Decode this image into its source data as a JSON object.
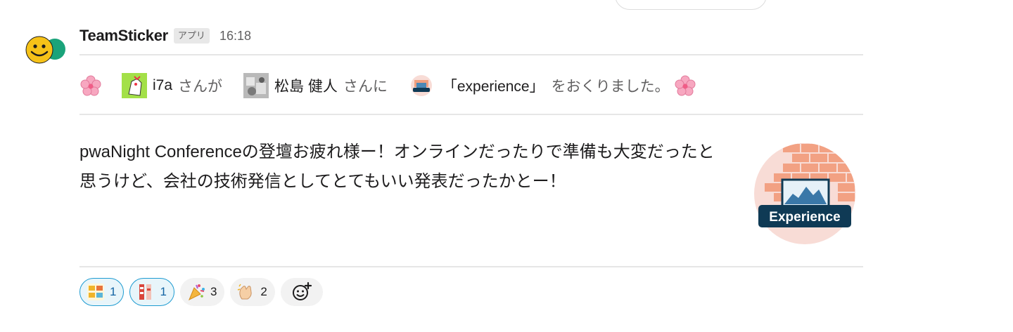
{
  "message": {
    "app_name": "TeamSticker",
    "app_badge": "アプリ",
    "timestamp": "16:18",
    "sticker_line": {
      "sender": "i7a",
      "sender_suffix": "さんが",
      "recipient": "松島 健人",
      "recipient_suffix": "さんに",
      "sticker_name": "「experience」",
      "action": "をおくりました。"
    },
    "body": "pwaNight Conferenceの登壇お疲れ様ー！オンラインだったりで準備も大変だったと思うけど、会社の技術発信としてとてもいい発表だったかとー！",
    "sticker_label": "Experience"
  },
  "reactions": [
    {
      "icon": "custom-text-emoji",
      "count": "1",
      "active": true
    },
    {
      "icon": "custom-tag-emoji",
      "count": "1",
      "active": true
    },
    {
      "icon": "party-popper-emoji",
      "count": "3",
      "active": false
    },
    {
      "icon": "clapping-hands-emoji",
      "count": "2",
      "active": false
    }
  ],
  "colors": {
    "active_reaction_border": "#1d9bd1",
    "active_reaction_bg": "#e8f5fa",
    "sticker_badge_bg": "#0f3a55",
    "sticker_circle_bg": "#f8dcd6"
  }
}
